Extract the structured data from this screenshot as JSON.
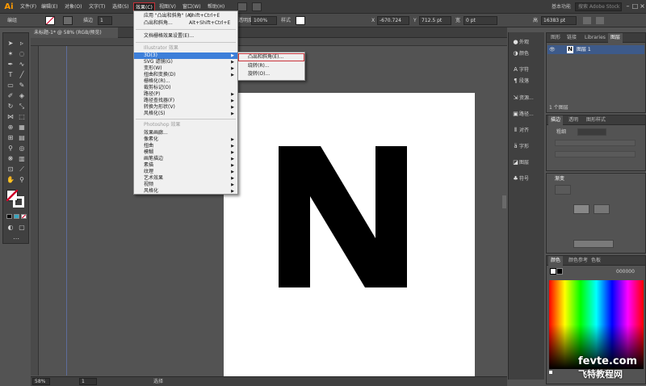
{
  "app": {
    "logo": "Ai",
    "doc_tab": "未标题-1* @ 58% (RGB/预览)",
    "workspace": "基本功能",
    "search_placeholder": "搜索 Adobe Stock"
  },
  "menu": [
    "文件(F)",
    "编辑(E)",
    "对象(O)",
    "文字(T)",
    "选择(S)",
    "效果(C)",
    "视图(V)",
    "窗口(W)",
    "帮助(H)"
  ],
  "control": {
    "selection": "编组",
    "stroke_label": "描边",
    "stroke_value": "1",
    "opacity_label": "不透明度",
    "opacity_value": "100%",
    "style_label": "样式",
    "x_label": "X",
    "x_value": "-670.724",
    "y_label": "Y",
    "y_value": "712.5 pt",
    "w_label": "宽",
    "w_value": "0 pt",
    "h_label": "高",
    "h_value": "16383 pt"
  },
  "effect_menu": {
    "apply": "应用 \"凸出和斜角\" (A)",
    "apply_shortcut": "Shift+Ctrl+E",
    "last": "凸出和斜角...",
    "last_shortcut": "Alt+Shift+Ctrl+E",
    "doc_raster": "文档栅格效果设置(E)...",
    "illustrator_header": "Illustrator 效果",
    "illustrator_items": [
      "3D(3)",
      "SVG 滤镜(G)",
      "变形(W)",
      "扭曲和变换(D)",
      "栅格化(R)...",
      "裁剪标记(O)",
      "路径(P)",
      "路径查找器(F)",
      "转换为形状(V)",
      "风格化(S)"
    ],
    "photoshop_header": "Photoshop 效果",
    "photoshop_items": [
      "效果画廊...",
      "像素化",
      "扭曲",
      "模糊",
      "画笔描边",
      "素描",
      "纹理",
      "艺术效果",
      "视频",
      "风格化"
    ]
  },
  "submenu_3d": [
    "凸出和斜角(E)...",
    "绕转(R)...",
    "旋转(O)..."
  ],
  "canvas": {
    "letter": "N",
    "zoom": "58%",
    "status": "选择"
  },
  "iconstrip": [
    "外观",
    "颜色",
    "字符",
    "段落",
    "资源...",
    "路径...",
    "对齐",
    "字形",
    "图层",
    "符号"
  ],
  "layers_panel": {
    "tabs": [
      "图形",
      "链接",
      "Libraries",
      "图层"
    ],
    "layer_name": "图层 1",
    "footer": "1 个图层"
  },
  "transform_panel": {
    "tabs": [
      "描边",
      "透明",
      "图形样式"
    ],
    "weight_label": "粗细"
  },
  "gradient_panel": {
    "title": "渐变"
  },
  "color_panel": {
    "tabs": [
      "颜色",
      "颜色参考",
      "色板"
    ],
    "hex": "000000"
  },
  "watermark": {
    "line1": "fevte.com",
    "line2": "飞特教程网"
  },
  "colors": {
    "menu_highlight": "#3d7fd9",
    "active_menu_border": "#c8333a",
    "logo": "#ff9a00"
  }
}
